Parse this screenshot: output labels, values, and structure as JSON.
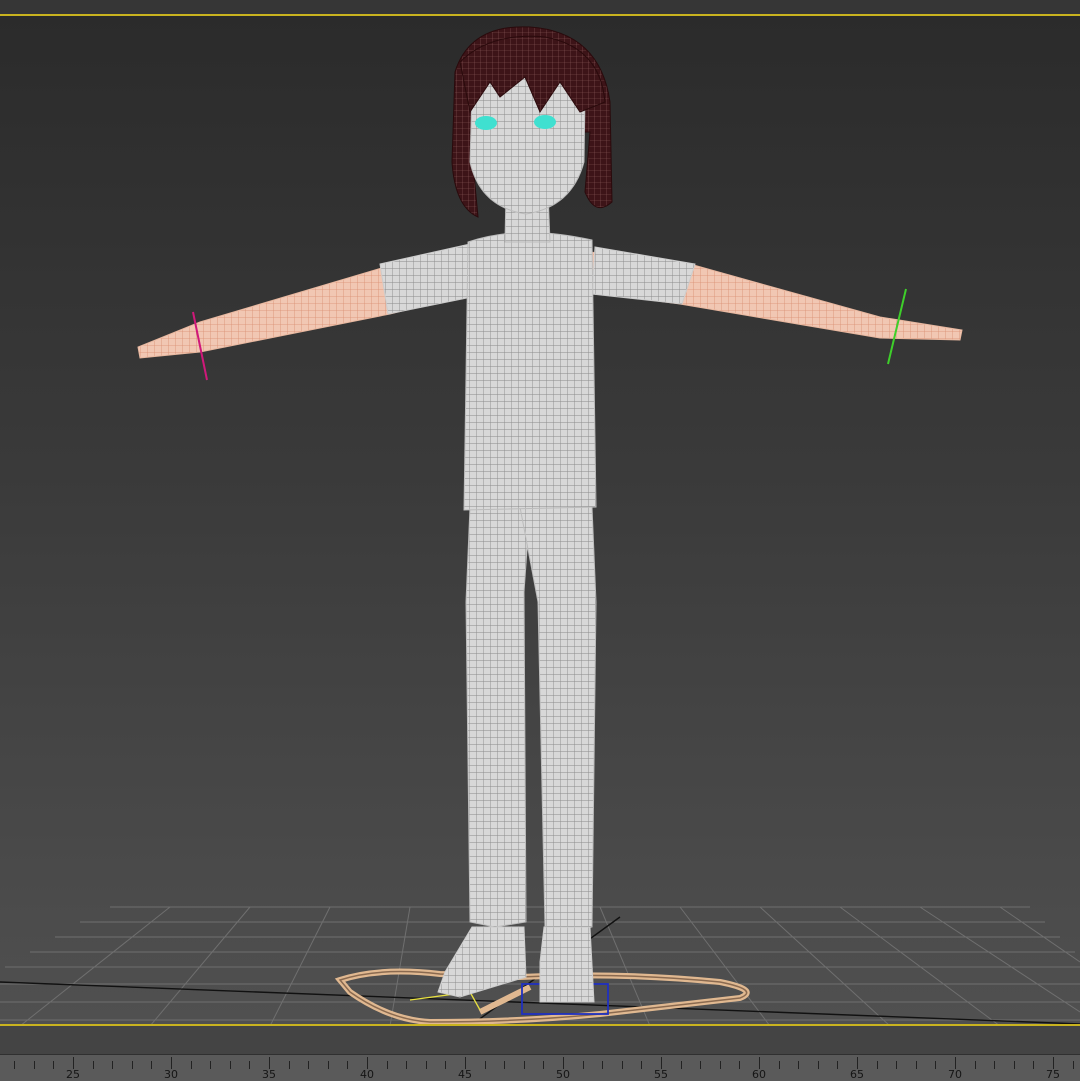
{
  "viewport": {
    "border_color": "#c9b31f",
    "model": "t-pose character wireframe",
    "gizmo_colors": {
      "left": "#d0187a",
      "right": "#3ecf2a"
    },
    "eye_color": "#3fe0d0"
  },
  "timeline": {
    "frame_labels": [
      "25",
      "30",
      "35",
      "40",
      "45",
      "50",
      "55",
      "60",
      "65",
      "70",
      "75"
    ]
  }
}
